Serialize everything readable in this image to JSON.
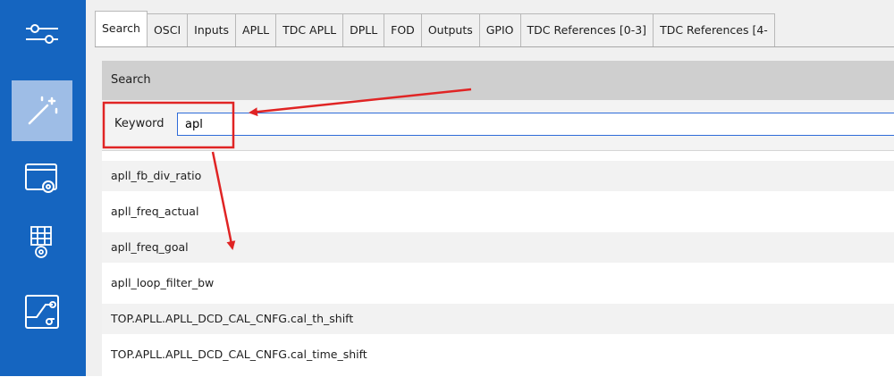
{
  "tabs": [
    {
      "label": "Search",
      "active": true
    },
    {
      "label": "OSCI"
    },
    {
      "label": "Inputs"
    },
    {
      "label": "APLL"
    },
    {
      "label": "TDC APLL"
    },
    {
      "label": "DPLL"
    },
    {
      "label": "FOD"
    },
    {
      "label": "Outputs"
    },
    {
      "label": "GPIO"
    },
    {
      "label": "TDC References [0-3]"
    },
    {
      "label": "TDC References [4-"
    }
  ],
  "search_panel": {
    "header": "Search",
    "keyword_label": "Keyword",
    "keyword_value": "apl"
  },
  "results": [
    "apll_fb_div_ratio",
    "apll_freq_actual",
    "apll_freq_goal",
    "apll_loop_filter_bw",
    "TOP.APLL.APLL_DCD_CAL_CNFG.cal_th_shift",
    "TOP.APLL.APLL_DCD_CAL_CNFG.cal_time_shift"
  ],
  "colors": {
    "sidebar": "#1565c0",
    "sidebar_active": "#9ebde6",
    "annotation": "#e02424",
    "input_border": "#2e6bd8"
  },
  "icons": [
    "sliders-icon",
    "magic-wand-icon",
    "window-gear-icon",
    "grid-gear-icon",
    "circuit-icon"
  ]
}
